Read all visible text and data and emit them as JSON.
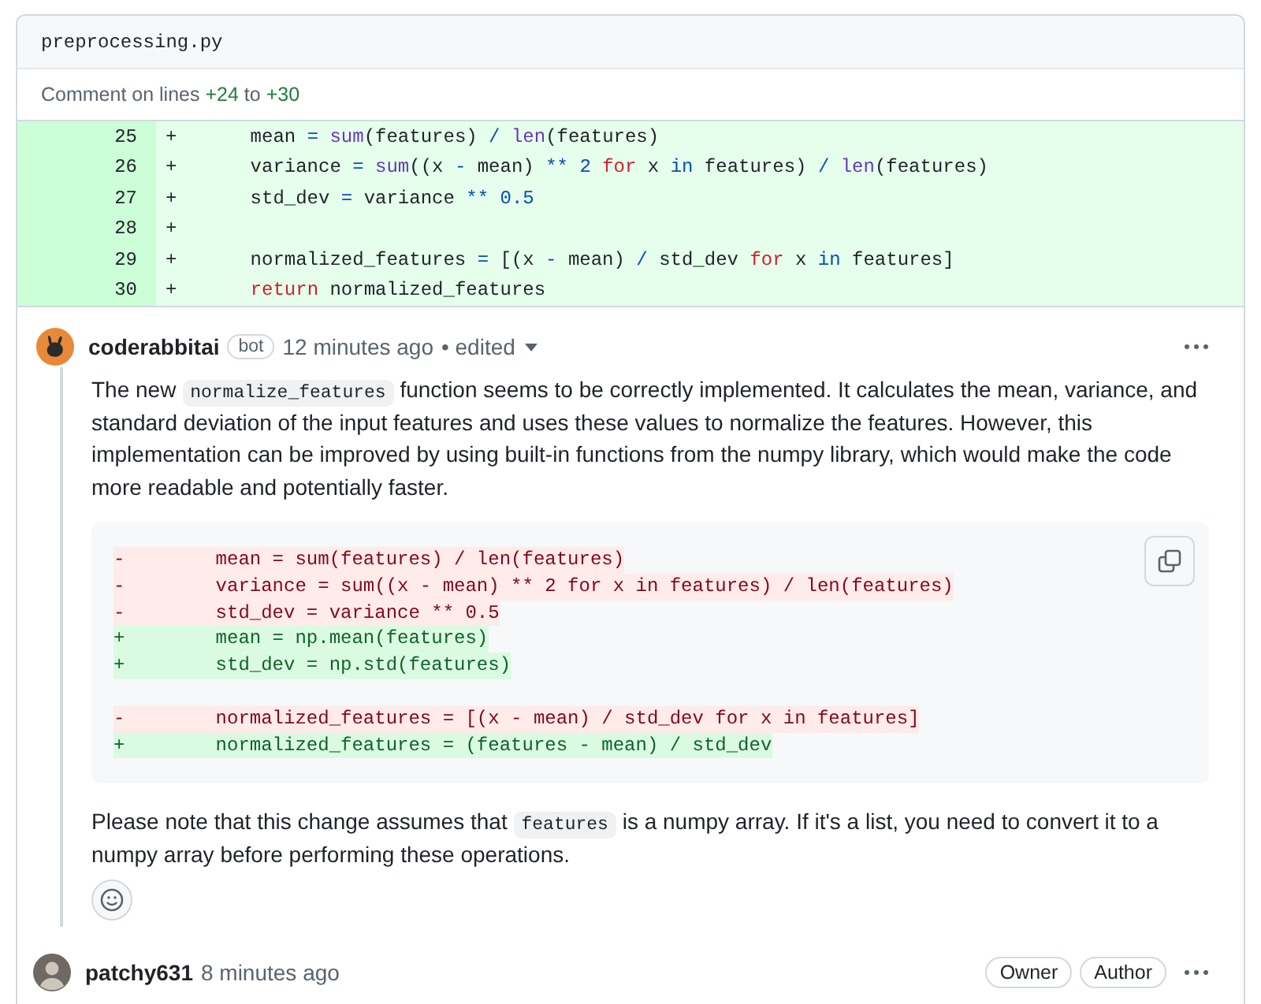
{
  "file": {
    "name": "preprocessing.py"
  },
  "range": {
    "prefix": "Comment on lines",
    "start": "+24",
    "joiner": "to",
    "end": "+30"
  },
  "diff": [
    {
      "number": "25",
      "sign": "+",
      "code": "    mean = sum(features) / len(features)"
    },
    {
      "number": "26",
      "sign": "+",
      "code": "    variance = sum((x - mean) ** 2 for x in features) / len(features)"
    },
    {
      "number": "27",
      "sign": "+",
      "code": "    std_dev = variance ** 0.5"
    },
    {
      "number": "28",
      "sign": "+"
    },
    {
      "number": "29",
      "sign": "+",
      "code": "    normalized_features = [(x - mean) / std_dev for x in features]"
    },
    {
      "number": "30",
      "sign": "+",
      "code": "    return normalized_features"
    }
  ],
  "comments": [
    {
      "kind": "bot",
      "author": "coderabbitai",
      "badge": "bot",
      "time": "12 minutes ago",
      "edited": "• edited",
      "body": [
        {
          "kind": "paragraph",
          "segments": [
            {
              "t": "The new ",
              "kind": "text"
            },
            {
              "t": "normalize_features",
              "kind": "code"
            },
            {
              "t": " function seems to be correctly implemented. It calculates the mean, variance, and standard deviation of the input features and uses these values to normalize the features. However, this implementation can be improved by using built-in functions from the numpy library, which would make the code more readable and potentially faster.",
              "kind": "text"
            }
          ]
        },
        {
          "kind": "suggestion",
          "lines": [
            {
              "sign": "-",
              "code": "    mean = sum(features) / len(features)",
              "kind": "removed"
            },
            {
              "sign": "-",
              "code": "    variance = sum((x - mean) ** 2 for x in features) / len(features)",
              "kind": "removed"
            },
            {
              "sign": "-",
              "code": "    std_dev = variance ** 0.5",
              "kind": "removed"
            },
            {
              "sign": "+",
              "code": "    mean = np.mean(features)",
              "kind": "added"
            },
            {
              "sign": "+",
              "code": "    std_dev = np.std(features)",
              "kind": "added"
            },
            {
              "kind": "blank"
            },
            {
              "sign": "-",
              "code": "    normalized_features = [(x - mean) / std_dev for x in features]",
              "kind": "removed"
            },
            {
              "sign": "+",
              "code": "    normalized_features = (features - mean) / std_dev",
              "kind": "added"
            }
          ]
        },
        {
          "kind": "paragraph",
          "segments": [
            {
              "t": "Please note that this change assumes that ",
              "kind": "text"
            },
            {
              "t": "features",
              "kind": "code"
            },
            {
              "t": " is a numpy array. If it's a list, you need to convert it to a numpy array before performing these operations.",
              "kind": "text"
            }
          ]
        }
      ]
    },
    {
      "kind": "user",
      "author": "patchy631",
      "time": "8 minutes ago",
      "roles": [
        "Owner",
        "Author"
      ]
    }
  ]
}
